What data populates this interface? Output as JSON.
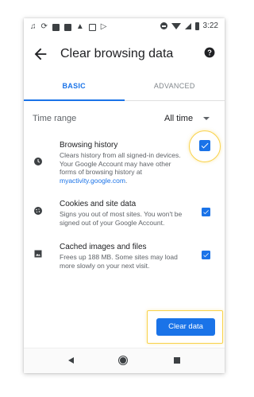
{
  "status_bar": {
    "time": "3:22",
    "icons_left": [
      "music-icon",
      "sync-icon",
      "pause-icon",
      "image-icon",
      "warning-icon",
      "android-icon",
      "play-store-icon"
    ],
    "icons_right": [
      "do-not-disturb-icon",
      "wifi-icon",
      "signal-icon",
      "battery-icon"
    ]
  },
  "app_bar": {
    "title": "Clear browsing data"
  },
  "tabs": [
    {
      "label": "BASIC",
      "active": true
    },
    {
      "label": "ADVANCED",
      "active": false
    }
  ],
  "time_range": {
    "label": "Time range",
    "value": "All time"
  },
  "options": [
    {
      "title": "Browsing history",
      "description": "Clears history from all signed-in devices. Your Google Account may have other forms of browsing history at",
      "link": "myactivity.google.com",
      "link_suffix": ".",
      "checked": true,
      "icon": "history-clock-icon"
    },
    {
      "title": "Cookies and site data",
      "description": "Signs you out of most sites. You won't be signed out of your Google Account.",
      "checked": true,
      "icon": "cookie-icon"
    },
    {
      "title": "Cached images and files",
      "description": "Frees up 188 MB. Some sites may load more slowly on your next visit.",
      "checked": true,
      "icon": "image-icon"
    }
  ],
  "clear_button": {
    "label": "Clear data"
  },
  "colors": {
    "accent": "#1a73e8",
    "highlight": "#f9d24a"
  }
}
